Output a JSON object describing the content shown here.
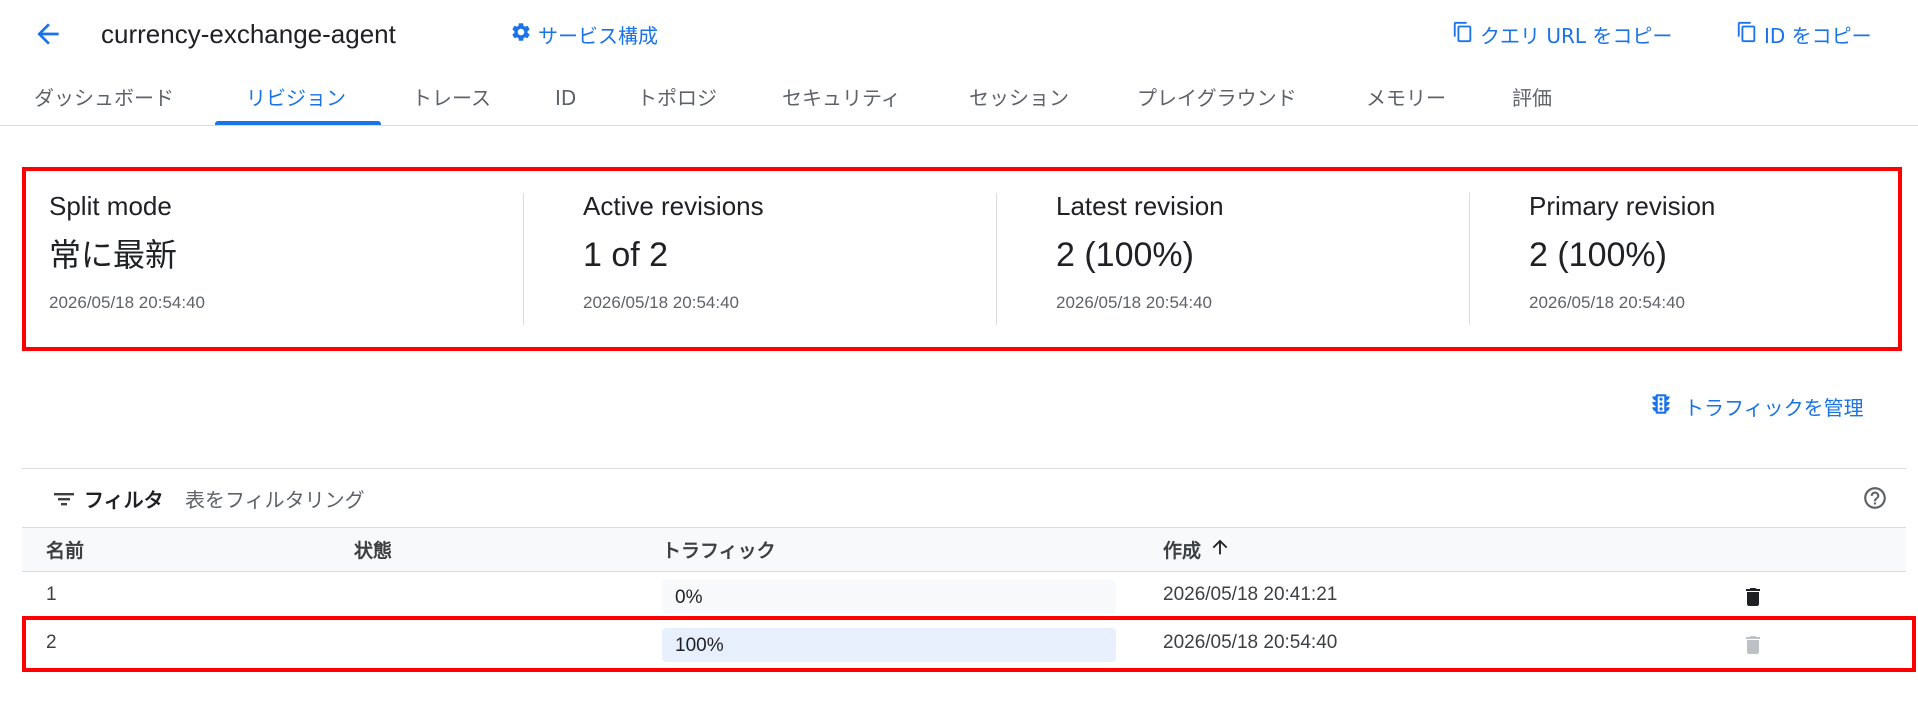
{
  "header": {
    "title": "currency-exchange-agent",
    "service_config": "サービス構成",
    "copy_query_url": "クエリ URL をコピー",
    "copy_id": "ID をコピー"
  },
  "tabs": [
    {
      "label": "ダッシュボード",
      "active": false
    },
    {
      "label": "リビジョン",
      "active": true
    },
    {
      "label": "トレース",
      "active": false
    },
    {
      "label": "ID",
      "active": false
    },
    {
      "label": "トポロジ",
      "active": false
    },
    {
      "label": "セキュリティ",
      "active": false
    },
    {
      "label": "セッション",
      "active": false
    },
    {
      "label": "プレイグラウンド",
      "active": false
    },
    {
      "label": "メモリー",
      "active": false
    },
    {
      "label": "評価",
      "active": false
    }
  ],
  "summary": [
    {
      "label": "Split mode",
      "value": "常に最新",
      "time": "2026/05/18 20:54:40"
    },
    {
      "label": "Active revisions",
      "value": "1 of 2",
      "time": "2026/05/18 20:54:40"
    },
    {
      "label": "Latest revision",
      "value": "2 (100%)",
      "time": "2026/05/18 20:54:40"
    },
    {
      "label": "Primary revision",
      "value": "2 (100%)",
      "time": "2026/05/18 20:54:40"
    }
  ],
  "manage_traffic": "トラフィックを管理",
  "filter": {
    "label": "フィルタ",
    "placeholder": "表をフィルタリング"
  },
  "table": {
    "columns": [
      "名前",
      "状態",
      "トラフィック",
      "作成"
    ],
    "rows": [
      {
        "name": "1",
        "status": "",
        "traffic": "0%",
        "traffic_value": 0,
        "created": "2026/05/18 20:41:21",
        "delete_enabled": true
      },
      {
        "name": "2",
        "status": "",
        "traffic": "100%",
        "traffic_value": 100,
        "created": "2026/05/18 20:54:40",
        "delete_enabled": false
      }
    ]
  },
  "colors": {
    "accent": "#1a73e8",
    "highlight": "#ff0000",
    "traffic_fill": "#e8f0fe"
  }
}
